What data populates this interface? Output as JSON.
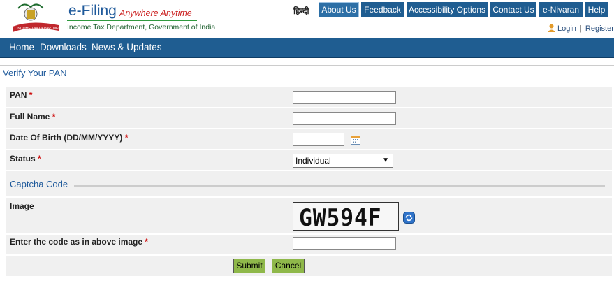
{
  "brand": {
    "title": "e-Filing",
    "tagline": "Anywhere Anytime",
    "subtitle": "Income Tax Department, Government of India",
    "emblem_text": "INCOME TAX DEPARTMENT"
  },
  "topnav": {
    "hindi": "हिन्दी",
    "items": [
      "About Us",
      "Feedback",
      "Accessibility Options",
      "Contact Us",
      "e-Nivaran",
      "Help"
    ]
  },
  "account": {
    "login": "Login",
    "separator": "|",
    "register": "Register"
  },
  "mainnav": {
    "items": [
      "Home",
      "Downloads",
      "News & Updates"
    ]
  },
  "form": {
    "title": "Verify Your PAN",
    "required_mark": "*",
    "fields": {
      "pan": {
        "label": "PAN",
        "value": ""
      },
      "full_name": {
        "label": "Full Name",
        "value": ""
      },
      "dob": {
        "label": "Date Of Birth (DD/MM/YYYY)",
        "value": ""
      },
      "status": {
        "label": "Status",
        "selected": "Individual"
      }
    },
    "captcha": {
      "section_title": "Captcha Code",
      "image_label": "Image",
      "code": "GW594F",
      "entry_label": "Enter the code as in above image",
      "entry_value": ""
    },
    "buttons": {
      "submit": "Submit",
      "cancel": "Cancel"
    }
  },
  "colors": {
    "nav_blue": "#1f5d91",
    "brand_blue": "#1f5a9b",
    "required_red": "#cc0000",
    "button_green": "#8fb84a"
  }
}
